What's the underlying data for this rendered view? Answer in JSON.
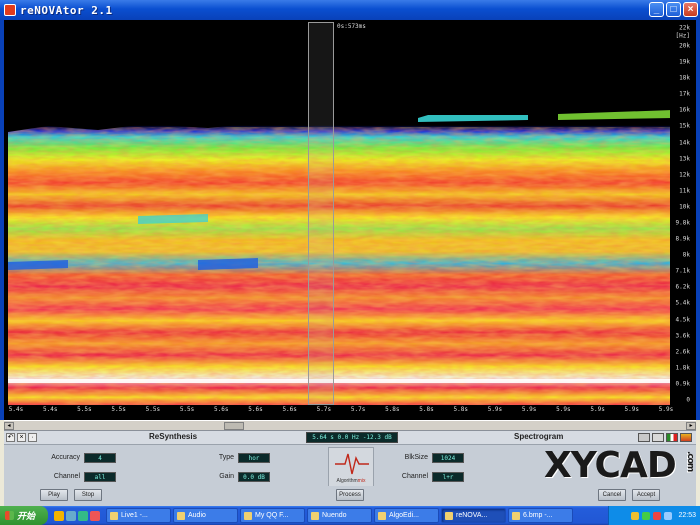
{
  "window": {
    "title": "reNOVAtor 2.1",
    "buttons": {
      "minimize": "_",
      "maximize": "□",
      "close": "×"
    }
  },
  "spectrogram": {
    "cursor_label": "0s:573ms",
    "freq_unit": "[Hz]",
    "freq_ticks": [
      "22k",
      "20k",
      "19k",
      "18k",
      "17k",
      "16k",
      "15k",
      "14k",
      "13k",
      "12k",
      "11k",
      "10k",
      "9.8k",
      "8.9k",
      "8k",
      "7.1k",
      "6.2k",
      "5.4k",
      "4.5k",
      "3.6k",
      "2.6k",
      "1.8k",
      "0.9k",
      "0"
    ],
    "time_ticks": [
      "5.4s",
      "5.4s",
      "5.5s",
      "5.5s",
      "5.5s",
      "5.5s",
      "5.6s",
      "5.6s",
      "5.6s",
      "5.7s",
      "5.7s",
      "5.8s",
      "5.8s",
      "5.8s",
      "5.9s",
      "5.9s",
      "5.9s",
      "5.9s",
      "5.9s",
      "5.9s"
    ],
    "selected_time_label": "5.6s"
  },
  "panel": {
    "left_title": "ReSynthesis",
    "right_title": "Spectrogram",
    "readout": "5.64 s   0.0 Hz   -12.3 dB",
    "fields": {
      "accuracy": {
        "label": "Accuracy",
        "value": "4"
      },
      "channel_left": {
        "label": "Channel",
        "value": "all"
      },
      "type": {
        "label": "Type",
        "value": "hor"
      },
      "gain": {
        "label": "Gain",
        "value": "0.0 dB"
      },
      "blksize": {
        "label": "BlkSize",
        "value": "1024"
      },
      "channel_right": {
        "label": "Channel",
        "value": "l+r"
      }
    },
    "logo": {
      "prefix": "Algorithm",
      "accent": "mix"
    },
    "buttons": {
      "play": "Play",
      "stop": "Stop",
      "process": "Process",
      "cancel": "Cancel",
      "accept": "Accept"
    }
  },
  "watermark": {
    "text": "XYCAD",
    "suffix": ".com"
  },
  "taskbar": {
    "start": "开始",
    "tasks": [
      "Live1 -...",
      "Audio",
      "My QQ F...",
      "Nuendo",
      "AlgoEdi...",
      "reNOVA...",
      "6.bmp -..."
    ],
    "active_task_index": 5,
    "clock": "22:53"
  }
}
